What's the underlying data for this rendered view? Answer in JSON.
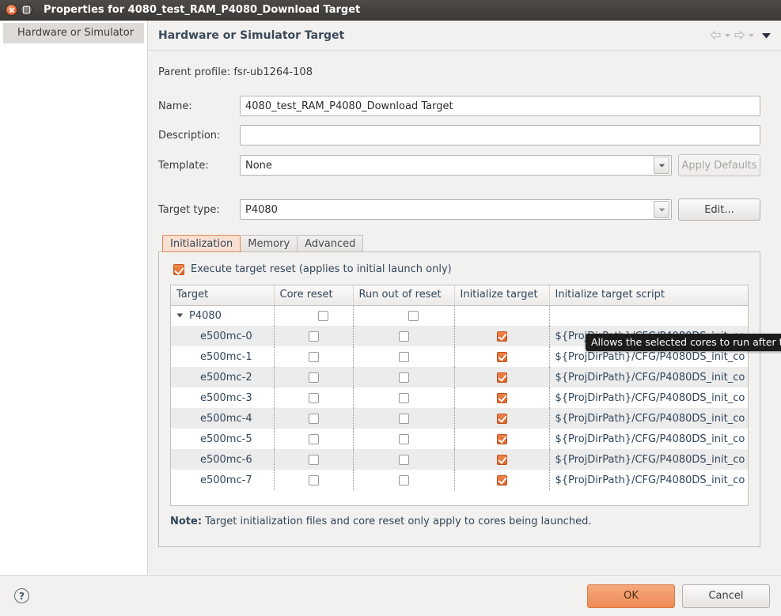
{
  "window": {
    "title": "Properties for 4080_test_RAM_P4080_Download Target",
    "close_icon": "close-icon",
    "maximize_icon": "maximize-icon"
  },
  "sidebar": {
    "items": [
      {
        "label": "Hardware or Simulator",
        "selected": true
      }
    ]
  },
  "pane": {
    "title": "Hardware or Simulator Target",
    "nav": {
      "back_icon": "back-arrow-icon",
      "back_menu_icon": "chevron-down-icon",
      "forward_icon": "forward-arrow-icon",
      "forward_menu_icon": "chevron-down-icon",
      "view_menu_icon": "chevron-down-icon"
    }
  },
  "form": {
    "parent_profile_label": "Parent profile:",
    "parent_profile_value": "fsr-ub1264-108",
    "name_label": "Name:",
    "name_value": "4080_test_RAM_P4080_Download Target",
    "name_placeholder": "",
    "description_label": "Description:",
    "description_value": "",
    "description_placeholder": "",
    "template_label": "Template:",
    "template_value": "None",
    "apply_defaults_label": "Apply Defaults",
    "target_type_label": "Target type:",
    "target_type_value": "P4080",
    "edit_label": "Edit..."
  },
  "tabs": [
    {
      "label": "Initialization",
      "active": true
    },
    {
      "label": "Memory",
      "active": false
    },
    {
      "label": "Advanced",
      "active": false
    }
  ],
  "init_panel": {
    "execute_reset_label": "Execute target reset (applies to initial launch only)",
    "execute_reset_checked": true,
    "tooltip": "Allows the selected cores to run after the reset",
    "note_prefix": "Note:",
    "note_text": " Target initialization files and core reset only apply to cores being launched.",
    "table": {
      "columns": [
        "Target",
        "Core reset",
        "Run out of reset",
        "Initialize target",
        "Initialize target script"
      ],
      "rows": [
        {
          "name": "P4080",
          "is_parent": true,
          "twisty": "triangle-down-icon",
          "core_reset": false,
          "run_out_of_reset": false,
          "initialize_target": false,
          "script": ""
        },
        {
          "name": "e500mc-0",
          "is_parent": false,
          "core_reset": false,
          "run_out_of_reset": false,
          "initialize_target": true,
          "script": "${ProjDirPath}/CFG/P4080DS_init_co"
        },
        {
          "name": "e500mc-1",
          "is_parent": false,
          "core_reset": false,
          "run_out_of_reset": false,
          "initialize_target": true,
          "script": "${ProjDirPath}/CFG/P4080DS_init_co"
        },
        {
          "name": "e500mc-2",
          "is_parent": false,
          "core_reset": false,
          "run_out_of_reset": false,
          "initialize_target": true,
          "script": "${ProjDirPath}/CFG/P4080DS_init_co"
        },
        {
          "name": "e500mc-3",
          "is_parent": false,
          "core_reset": false,
          "run_out_of_reset": false,
          "initialize_target": true,
          "script": "${ProjDirPath}/CFG/P4080DS_init_co"
        },
        {
          "name": "e500mc-4",
          "is_parent": false,
          "core_reset": false,
          "run_out_of_reset": false,
          "initialize_target": true,
          "script": "${ProjDirPath}/CFG/P4080DS_init_co"
        },
        {
          "name": "e500mc-5",
          "is_parent": false,
          "core_reset": false,
          "run_out_of_reset": false,
          "initialize_target": true,
          "script": "${ProjDirPath}/CFG/P4080DS_init_co"
        },
        {
          "name": "e500mc-6",
          "is_parent": false,
          "core_reset": false,
          "run_out_of_reset": false,
          "initialize_target": true,
          "script": "${ProjDirPath}/CFG/P4080DS_init_co"
        },
        {
          "name": "e500mc-7",
          "is_parent": false,
          "core_reset": false,
          "run_out_of_reset": false,
          "initialize_target": true,
          "script": "${ProjDirPath}/CFG/P4080DS_init_co"
        }
      ]
    }
  },
  "footer": {
    "help_icon": "help-icon",
    "help_glyph": "?",
    "ok_label": "OK",
    "cancel_label": "Cancel"
  },
  "colors": {
    "accent": "#ef8b56",
    "checkbox_checked": "#e2642b",
    "tab_active_bg": "#fbe0d2",
    "tab_active_border": "#e08a58",
    "title_bar": "#423f3c",
    "link_text": "#32465a"
  }
}
